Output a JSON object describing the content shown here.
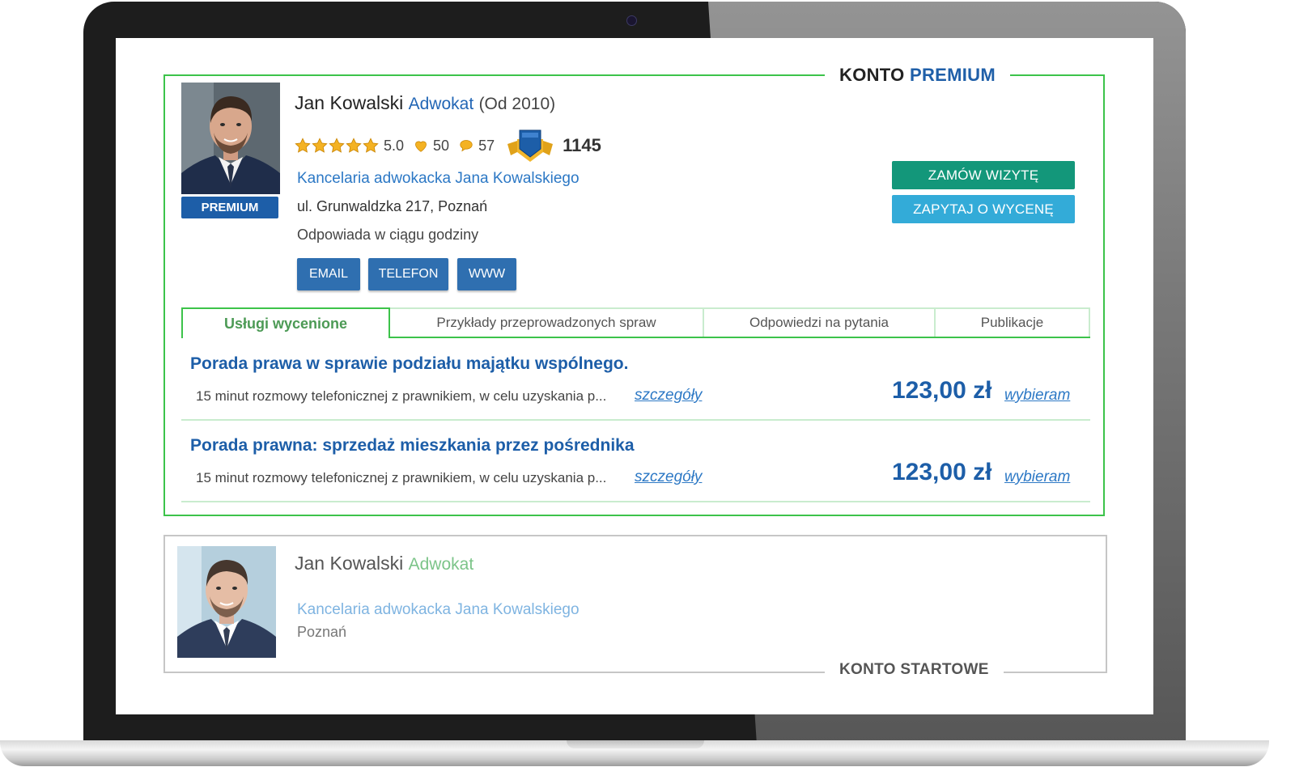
{
  "premium": {
    "label_prefix": "KONTO",
    "label_accent": "PREMIUM",
    "badge": "PREMIUM",
    "name": "Jan Kowalski",
    "role": "Adwokat",
    "since": "(Od 2010)",
    "rating": "5.0",
    "likes": "50",
    "comments": "57",
    "points": "1145",
    "firm": "Kancelaria adwokacka Jana Kowalskiego",
    "address": "ul. Grunwaldzka 217, Poznań",
    "response": "Odpowiada w ciągu godziny",
    "buttons": {
      "email": "EMAIL",
      "phone": "TELEFON",
      "www": "WWW"
    },
    "cta": {
      "visit": "ZAMÓW WIZYTĘ",
      "quote": "ZAPYTAJ O WYCENĘ"
    },
    "tabs": [
      {
        "label": "Usługi wycenione",
        "active": true
      },
      {
        "label": "Przykłady przeprowadzonych spraw",
        "active": false
      },
      {
        "label": "Odpowiedzi na pytania",
        "active": false
      },
      {
        "label": "Publikacje",
        "active": false
      }
    ],
    "services": [
      {
        "title": "Porada prawa w sprawie podziału majątku wspólnego.",
        "description": "15 minut rozmowy telefonicznej z prawnikiem, w celu uzyskania p...",
        "details": "szczegóły",
        "price": "123,00 zł",
        "choose": "wybieram"
      },
      {
        "title": "Porada prawna: sprzedaż mieszkania przez pośrednika",
        "description": "15 minut rozmowy telefonicznej z prawnikiem, w celu uzyskania p...",
        "details": "szczegóły",
        "price": "123,00 zł",
        "choose": "wybieram"
      }
    ]
  },
  "starter": {
    "label": "KONTO STARTOWE",
    "name": "Jan Kowalski",
    "role": "Adwokat",
    "firm": "Kancelaria adwokacka Jana Kowalskiego",
    "city": "Poznań"
  },
  "icons": {
    "star": "star-icon",
    "like": "heart-icon",
    "comment": "speech-bubble-icon",
    "shield": "shield-icon",
    "camera": "camera-icon"
  },
  "colors": {
    "premium_border": "#3cc34a",
    "brand_blue": "#1d5ea8",
    "link_blue": "#2c78c5",
    "cta_green": "#13977a",
    "cta_blue": "#33abd8",
    "starter_border": "#c6c6c6"
  }
}
